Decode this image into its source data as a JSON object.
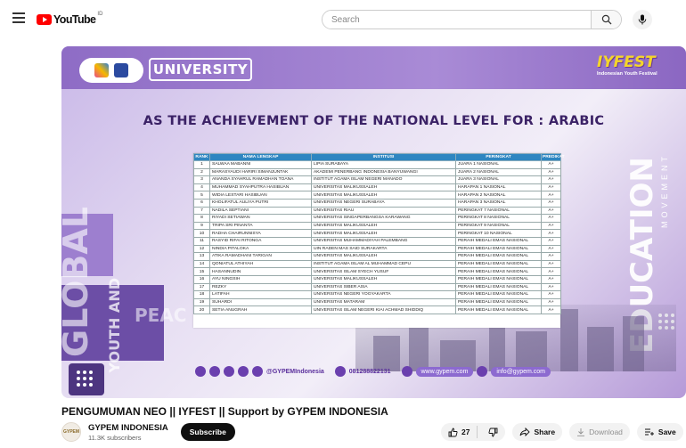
{
  "header": {
    "logo_text": "YouTube",
    "logo_country": "ID",
    "search_placeholder": "Search"
  },
  "video": {
    "badge_label": "UNIVERSITY",
    "brand_title": "IYFEST",
    "brand_subtitle": "Indonesian Youth Festival",
    "headline": "AS THE ACHIEVEMENT OF THE NATIONAL LEVEL FOR : ARABIC",
    "side_text_left": "GLOBAL",
    "side_text_youth": "YOUTH AND",
    "side_text_peace": "PEAC",
    "side_text_edu": "EDUCATION",
    "side_text_move": "MOVEMENT",
    "table": {
      "headers": [
        "RANK",
        "NAMA LENGKAP",
        "INSTITUSI",
        "PERINGKAT",
        "PREDIKAT"
      ],
      "rows": [
        [
          "1",
          "SALWAA MABANNI",
          "LIPIA SURABAYA",
          "JUARA 1 NASIONAL",
          "A+"
        ],
        [
          "2",
          "MARASYAUDI HARIRI SIMANJUNTAK",
          "AKADEMI PENERBANG INDONESIA BANYUWANGI",
          "JUARA 2 NASIONAL",
          "A+"
        ],
        [
          "3",
          "ANANDA SYAHRUL RAMADHAN TOANA",
          "INSTITUT AGAMA ISLAM NEGERI MANADO",
          "JUARA 3 NASIONAL",
          "A+"
        ],
        [
          "4",
          "MUHAMMAD SYAHPUTRA HASIBUAN",
          "UNIVERSITAS MALIKUSSALEH",
          "HARAPAN 1 NASIONAL",
          "A+"
        ],
        [
          "5",
          "WIDIA LESTARI HASIBUAN",
          "UNIVERSITAS MALIKUSSALEH",
          "HARAPAN 2 NASIONAL",
          "A+"
        ],
        [
          "6",
          "KHOLIFATUL AULIYA PUTRI",
          "UNIVERSITAS NEGERI SURABAYA",
          "HARAPAN 3 NASIONAL",
          "A+"
        ],
        [
          "7",
          "NADILA SEPTIANI",
          "UNIVERSITAS RIAU",
          "PERINGKAT 7 NASIONAL",
          "A+"
        ],
        [
          "8",
          "RIYADI SETIAWAN",
          "UNIVERSITAS SINGAPERBANGSA KARAWANG",
          "PERINGKAT 8 NASIONAL",
          "A+"
        ],
        [
          "9",
          "TRIPA SRI PINANTA",
          "UNIVERSITAS MALIKUSSALEH",
          "PERINGKAT 9 NASIONAL",
          "A+"
        ],
        [
          "10",
          "RADHA CHAIRUNNISYA",
          "UNIVERSITAS MALIKUSSALEH",
          "PERINGKAT 10 NASIONAL",
          "A+"
        ],
        [
          "11",
          "RASYID RIFAI RITONGA",
          "UNIVERSITAS MUHAMMADIYAH PALEMBANG",
          "PERAIH MEDALI EMAS NASIONAL",
          "A+"
        ],
        [
          "12",
          "NINDIA PITALOKA",
          "UIN RADEN MAS SAID SURAKARTA",
          "PERAIH MEDALI EMAS NASIONAL",
          "A+"
        ],
        [
          "13",
          "ATIKA RAMADHANI TARIGAN",
          "UNIVERSITAS MALIKUSSALEH",
          "PERAIH MEDALI EMAS NASIONAL",
          "A+"
        ],
        [
          "14",
          "QONIATUL ATHIYAH",
          "INSTITUT AGAMA ISLAM AL MUHAMMAD CEPU",
          "PERAIH MEDALI EMAS NASIONAL",
          "A+"
        ],
        [
          "15",
          "HASANNUDIN",
          "UNIVERSITAS ISLAM SYECH YUSUF",
          "PERAIH MEDALI EMAS NASIONAL",
          "A+"
        ],
        [
          "16",
          "AYU NINGSIH",
          "UNIVERSITAS MALIKUSSALEH",
          "PERAIH MEDALI EMAS NASIONAL",
          "A+"
        ],
        [
          "17",
          "REZKY",
          "UNIVERSITAS SIBER ASIA",
          "PERAIH MEDALI EMAS NASIONAL",
          "A+"
        ],
        [
          "18",
          "LATIFAH",
          "UNIVERSITAS NEGERI YOGYAKARTA",
          "PERAIH MEDALI EMAS NASIONAL",
          "A+"
        ],
        [
          "19",
          "SUHARDI",
          "UNIVERSITAS MATARAM",
          "PERAIH MEDALI EMAS NASIONAL",
          "A+"
        ],
        [
          "20",
          "SETIA ANUGRAH",
          "UNIVERSITAS ISLAM NEGERI KIAI ACHMAD SHIDDIQ",
          "PERAIH MEDALI EMAS NASIONAL",
          "A+"
        ]
      ]
    },
    "social_handle": "@GYPEMIndonesia",
    "social_phone": "081288822131",
    "social_web": "www.gypem.com",
    "social_email": "info@gypem.com"
  },
  "title": "PENGUMUMAN NEO || IYFEST || Support by GYPEM INDONESIA",
  "channel": {
    "avatar_text": "GYPEM",
    "name": "GYPEM INDONESIA",
    "subscribers": "11.3K subscribers",
    "subscribe_label": "Subscribe"
  },
  "actions": {
    "like_count": "27",
    "share_label": "Share",
    "download_label": "Download",
    "save_label": "Save",
    "more_label": "..."
  },
  "colors": {
    "brand_red": "#ff0000",
    "table_header": "#2e86c1",
    "accent_purple": "#8e6cc5"
  }
}
